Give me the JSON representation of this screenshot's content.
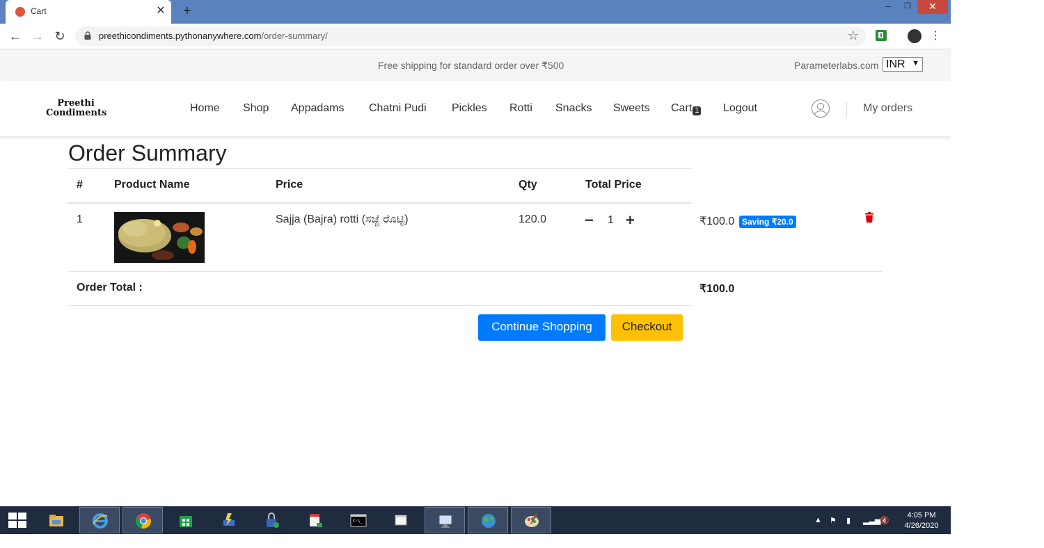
{
  "browser": {
    "tab_title": "Cart",
    "url_host": "preethicondiments.pythonanywhere.com",
    "url_path": "/order-summary/"
  },
  "topbar": {
    "shipping_text": "Free shipping for standard order over ₹500",
    "company": "Parameterlabs.com",
    "currency": "INR"
  },
  "header": {
    "logo_line1": "Preethi",
    "logo_line2": "Condiments",
    "nav": {
      "home": "Home",
      "shop": "Shop",
      "appadams": "Appadams",
      "chatni_pudi": "Chatni Pudi",
      "pickles": "Pickles",
      "rotti": "Rotti",
      "snacks": "Snacks",
      "sweets": "Sweets",
      "cart": "Cart",
      "cart_count": "1",
      "logout": "Logout"
    },
    "my_orders": "My orders"
  },
  "order": {
    "title": "Order Summary",
    "columns": {
      "index": "#",
      "product_name": "Product Name",
      "price": "Price",
      "qty": "Qty",
      "total_price": "Total Price"
    },
    "items": [
      {
        "index": "1",
        "name": "Sajja (Bajra) rotti (ಸಜ್ಜೆ ರೊಟ್ಟಿ)",
        "price": "120.0",
        "qty": "1",
        "total": "₹100.0",
        "saving": "Saving ₹20.0"
      }
    ],
    "total_label": "Order Total :",
    "total_value": "₹100.0",
    "continue_label": "Continue Shopping",
    "checkout_label": "Checkout"
  },
  "taskbar": {
    "time": "4:05 PM",
    "date": "4/26/2020"
  },
  "colors": {
    "primary": "#007bff",
    "warning": "#ffc107",
    "danger": "#e00000",
    "titlebar": "#5a82bf",
    "taskbar": "#1f2b3e"
  }
}
